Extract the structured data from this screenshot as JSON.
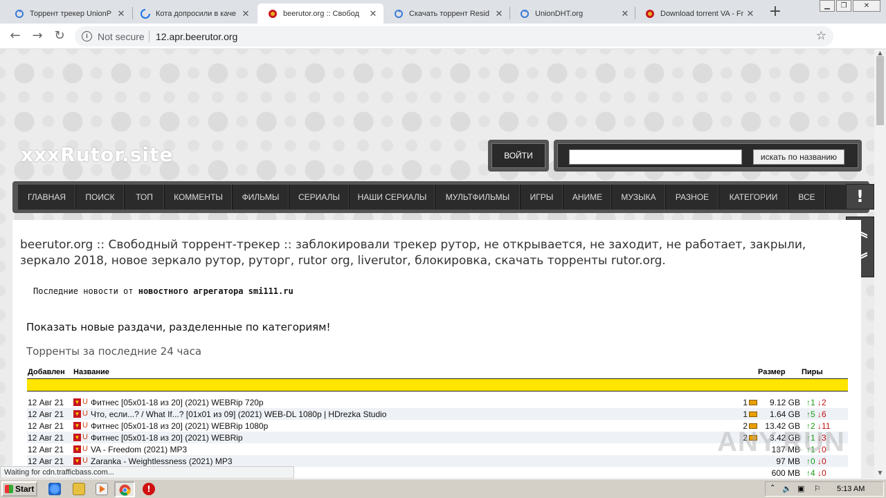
{
  "browser": {
    "tabs": [
      {
        "title": "Торрент трекер UnionP",
        "icon": "sync-icon"
      },
      {
        "title": "Кота допросили в каче",
        "icon": "loading-icon"
      },
      {
        "title": "beerutor.org :: Свобод",
        "icon": "ussr-emblem-icon",
        "active": true
      },
      {
        "title": "Скачать торрент Resid",
        "icon": "sync-icon"
      },
      {
        "title": "UnionDHT.org",
        "icon": "sync-icon"
      },
      {
        "title": "Download torrent VA - Fr",
        "icon": "ussr-emblem-icon"
      }
    ],
    "not_secure": "Not secure",
    "url": "12.apr.beerutor.org",
    "status": "Waiting for cdn.trafficbass.com..."
  },
  "site": {
    "logo": "xxxRutor.site",
    "login_label": "ВОЙТИ",
    "search_button": "искать по названию",
    "menu": [
      "ГЛАВНАЯ",
      "ПОИСК",
      "ТОП",
      "КОММЕНТЫ",
      "ФИЛЬМЫ",
      "СЕРИАЛЫ",
      "НАШИ СЕРИАЛЫ",
      "МУЛЬТФИЛЬМЫ",
      "ИГРЫ",
      "АНИМЕ",
      "МУЗЫКА",
      "РАЗНОЕ",
      "КАТЕГОРИИ",
      "ВСЕ"
    ],
    "headline": "beerutor.org :: Свободный торрент-трекер :: заблокировали трекер рутор, не открывается, не заходит, не работает, закрыли, зеркало 2018, новое зеркало рутор, руторг, rutor org, liverutor, блокировка, скачать торренты rutor.org.",
    "news_prefix": "Последние новости от",
    "news_source": "новостного агрегатора smi111.ru",
    "show_new": "Показать новые раздачи, разделенные по категориям!",
    "last24": "Торренты за последние 24 часа",
    "columns": {
      "added": "Добавлен",
      "name": "Название",
      "size": "Размер",
      "peers": "Пиры"
    },
    "torrents": [
      {
        "date": "12 Авг 21",
        "name": "Фитнес [05x01-18 из 20] (2021) WEBRip 720p",
        "comments": "1",
        "size": "9.12 GB",
        "seeds": "1",
        "leech": "2"
      },
      {
        "date": "12 Авг 21",
        "name": "Что, если...? / What If...? [01x01 из 09] (2021) WEB-DL 1080p | HDrezka Studio",
        "comments": "1",
        "size": "1.64 GB",
        "seeds": "5",
        "leech": "6"
      },
      {
        "date": "12 Авг 21",
        "name": "Фитнес [05x01-18 из 20] (2021) WEBRip 1080p",
        "comments": "2",
        "size": "13.42 GB",
        "seeds": "2",
        "leech": "11"
      },
      {
        "date": "12 Авг 21",
        "name": "Фитнес [05x01-18 из 20] (2021) WEBRip",
        "comments": "2",
        "size": "3.42 GB",
        "seeds": "1",
        "leech": "3"
      },
      {
        "date": "12 Авг 21",
        "name": "VA - Freedom (2021) MP3",
        "comments": "",
        "size": "137 MB",
        "seeds": "1",
        "leech": "0"
      },
      {
        "date": "12 Авг 21",
        "name": "Zaranka - Weightlessness (2021) MP3",
        "comments": "",
        "size": "97 MB",
        "seeds": "0",
        "leech": "0"
      },
      {
        "date": "",
        "name": "",
        "comments": "",
        "size": "600 MB",
        "seeds": "4",
        "leech": "0"
      }
    ],
    "watermark": "ANY.RUN"
  },
  "taskbar": {
    "start": "Start",
    "clock": "5:13 AM"
  },
  "colors": {
    "accent_yellow": "#ffe500",
    "menu_dark": "#2b2b2b"
  }
}
